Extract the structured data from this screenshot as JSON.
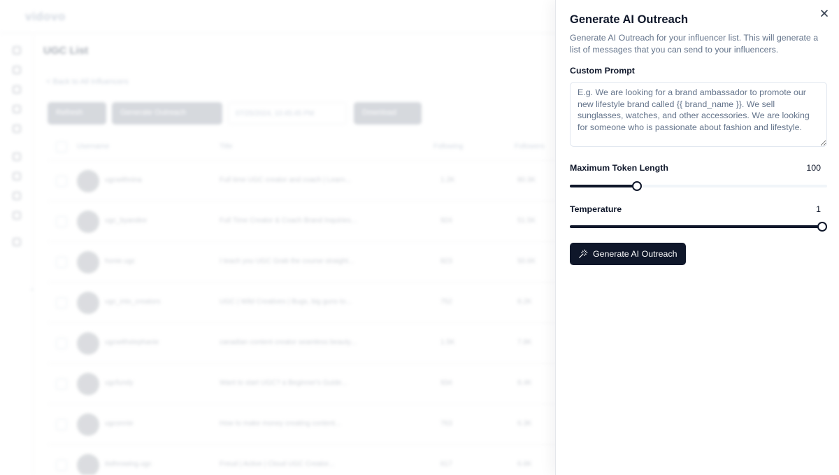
{
  "background": {
    "logo": "vidovo",
    "page_title": "UGC List",
    "back_link": "< Back to All Influencers",
    "toolbar": {
      "button1": "Refresh",
      "button2": "Generate Outreach",
      "date": "07/25/2024, 10:45:45 PM",
      "button3": "Download"
    },
    "table_headers": [
      "Username",
      "Title",
      "Following",
      "Followers"
    ],
    "rows": [
      {
        "username": "ugcwithnina",
        "title": "Full time UGC creator and coach | Learn...",
        "following": "1.2K",
        "followers": "80.3K"
      },
      {
        "username": "ugc_byandee",
        "title": "Full Time Creator & Coach Brand Inquiries...",
        "following": "924",
        "followers": "51.5K"
      },
      {
        "username": "honie.ugc",
        "title": "I teach you UGC Grab the course straight...",
        "following": "823",
        "followers": "50.6K"
      },
      {
        "username": "ugc_into_creators",
        "title": "UGC | Wild Creatives | Bugs, big guns to...",
        "following": "752",
        "followers": "8.2K"
      },
      {
        "username": "ugcwithstephanie",
        "title": "canadian content creator seamless beauty...",
        "following": "1.5K",
        "followers": "7.8K"
      },
      {
        "username": "ugcfundy",
        "title": "Want to start UGC? a Beginner's Guide...",
        "following": "934",
        "followers": "8.4K"
      },
      {
        "username": "ugconnie",
        "title": "How to make money creating content...",
        "following": "763",
        "followers": "6.3K"
      },
      {
        "username": "itsthrowing.ugc",
        "title": "Freud | Active | Cloud UGC Creator...",
        "following": "617",
        "followers": "6.6K"
      }
    ]
  },
  "sheet": {
    "title": "Generate AI Outreach",
    "description": "Generate AI Outreach for your influencer list. This will generate a list of messages that you can send to your influencers.",
    "custom_prompt": {
      "label": "Custom Prompt",
      "value": "",
      "placeholder": "E.g. We are looking for a brand ambassador to promote our new lifestyle brand called {{ brand_name }}. We sell sunglasses, watches, and other accessories. We are looking for someone who is passionate about fashion and lifestyle."
    },
    "max_token_length": {
      "label": "Maximum Token Length",
      "value": "100",
      "fraction": 0.26
    },
    "temperature": {
      "label": "Temperature",
      "value": "1",
      "fraction": 1.0
    },
    "generate_button": {
      "label": "Generate AI Outreach",
      "icon": "wand-sparkles-icon"
    },
    "close_icon": "close-icon"
  },
  "colors": {
    "primary": "#0f172a",
    "muted_text": "#64748b",
    "border": "#e2e8f0",
    "slider_track": "#f1f5f9"
  }
}
